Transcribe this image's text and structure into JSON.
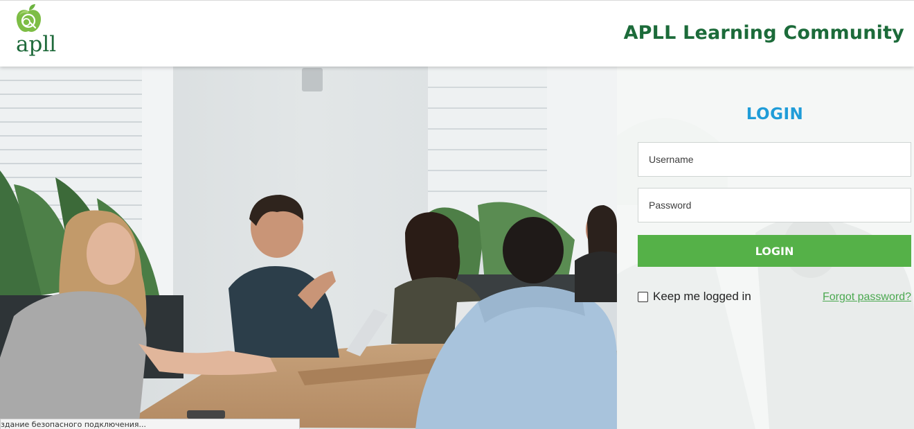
{
  "header": {
    "logo_text": "apll",
    "site_title": "APLL Learning Community"
  },
  "login": {
    "title": "LOGIN",
    "username_placeholder": "Username",
    "password_placeholder": "Password",
    "button_label": "LOGIN",
    "remember_label": "Keep me logged in",
    "forgot_label": "Forgot password?"
  },
  "statusbar": {
    "text": "здание безопасного подключения..."
  },
  "colors": {
    "brand_green": "#1c6b3a",
    "login_title_blue": "#1f9cd8",
    "button_green": "#55b148",
    "link_green": "#4aa84f"
  },
  "icons": {
    "logo": "apple-logo-icon",
    "checkbox": "checkbox-icon"
  }
}
